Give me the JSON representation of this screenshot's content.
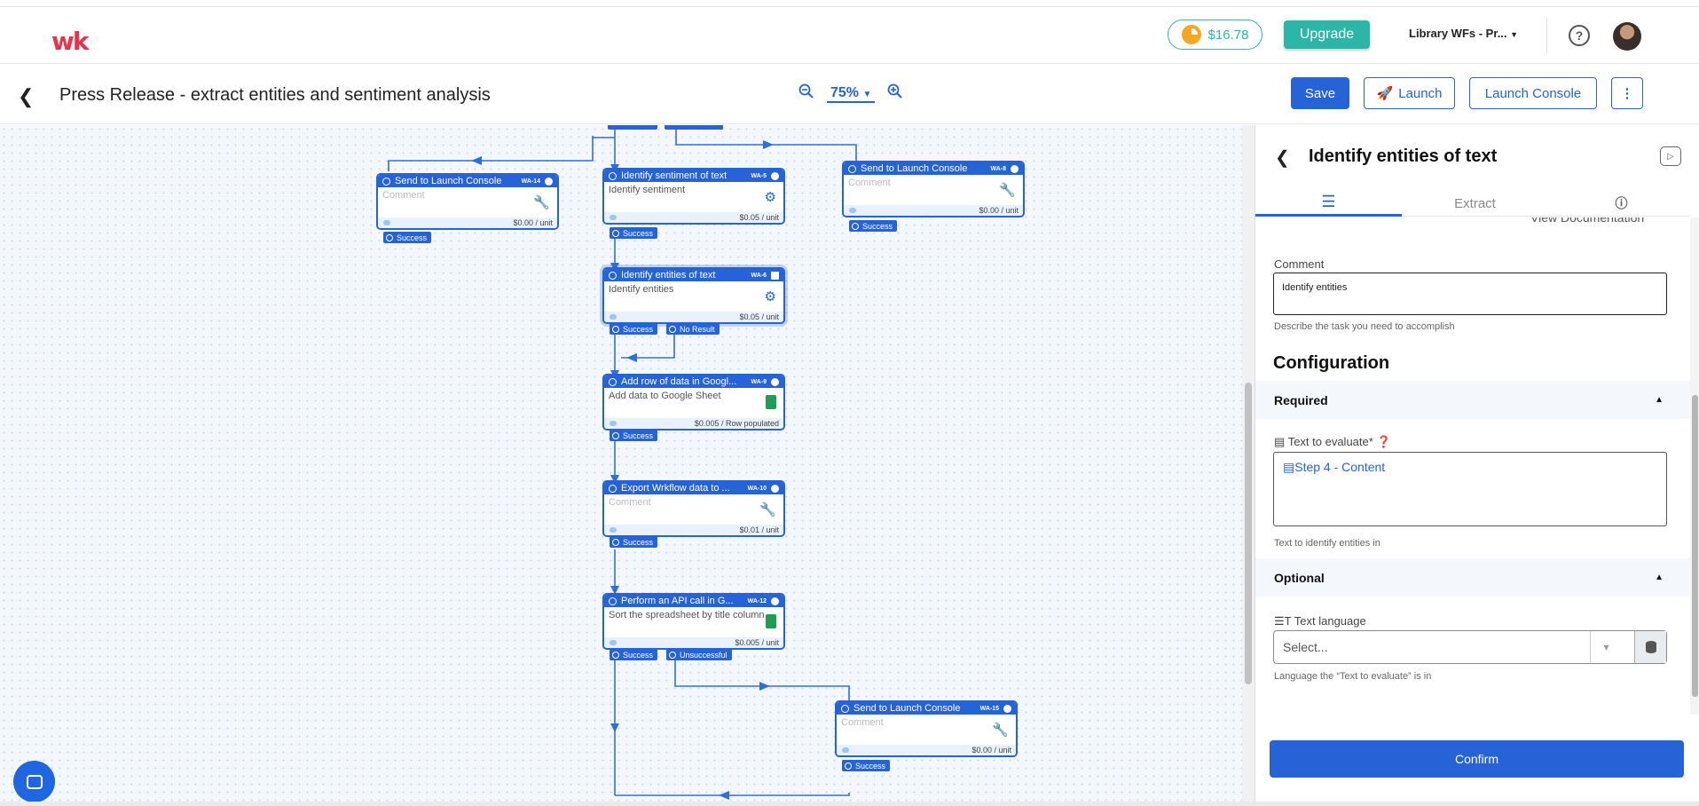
{
  "app": {
    "logo_text": "wk",
    "credits": "$16.78",
    "upgrade_label": "Upgrade",
    "workspace": "Library WFs - Pr...",
    "help_symbol": "?"
  },
  "toolbar": {
    "title": "Press Release - extract entities and sentiment analysis",
    "zoom": "75%",
    "save_label": "Save",
    "launch_label": "Launch",
    "launch_console_label": "Launch Console",
    "more_symbol": "⋮"
  },
  "nodes": [
    {
      "name": "Send to Launch Console",
      "tag": "WA-14",
      "comment": "Comment",
      "placeholder": true,
      "price": "$0.00 / unit",
      "tool": "wrench-icon"
    },
    {
      "name": "Identify sentiment of text",
      "tag": "WA-5",
      "comment": "Identify sentiment",
      "placeholder": false,
      "price": "$0.05 / unit",
      "tool": "ai-icon"
    },
    {
      "name": "Send to Launch Console",
      "tag": "WA-8",
      "comment": "Comment",
      "placeholder": true,
      "price": "$0.00 / unit",
      "tool": "wrench-icon"
    },
    {
      "name": "Identify entities of text",
      "tag": "WA-6",
      "comment": "Identify entities",
      "placeholder": false,
      "price": "$0.05 / unit",
      "tool": "ai-icon"
    },
    {
      "name": "Add row of data in Googl...",
      "tag": "WA-9",
      "comment": "Add data to Google Sheet",
      "placeholder": false,
      "price": "$0.005 / Row populated",
      "tool": "sheets-icon"
    },
    {
      "name": "Export Wrkflow data to ...",
      "tag": "WA-10",
      "comment": "Comment",
      "placeholder": true,
      "price": "$0.01 / unit",
      "tool": "wrench-icon"
    },
    {
      "name": "Perform an API call in G...",
      "tag": "WA-12",
      "comment": "Sort the spreadsheet by title column",
      "placeholder": false,
      "price": "$0.005 / unit",
      "tool": "sheets-icon"
    },
    {
      "name": "Send to Launch Console",
      "tag": "WA-15",
      "comment": "Comment",
      "placeholder": true,
      "price": "$0.00 / unit",
      "tool": "wrench-icon"
    }
  ],
  "pills": {
    "success": "Success",
    "no_result": "No Result",
    "unsuccessful": "Unsuccessful"
  },
  "panel": {
    "title": "Identify entities of text",
    "tab_extract": "Extract",
    "view_doc": "View Documentation",
    "comment_label": "Comment",
    "comment_value": "Identify entities",
    "comment_hint": "Describe the task you need to accomplish",
    "configuration": "Configuration",
    "required": "Required",
    "text_label": "Text to evaluate*",
    "text_value": "Step 4 - Content",
    "text_hint": "Text to identify entities in",
    "optional": "Optional",
    "lang_label": "Text language",
    "lang_placeholder": "Select...",
    "lang_hint": "Language the “Text to evaluate” is in",
    "confirm": "Confirm"
  }
}
